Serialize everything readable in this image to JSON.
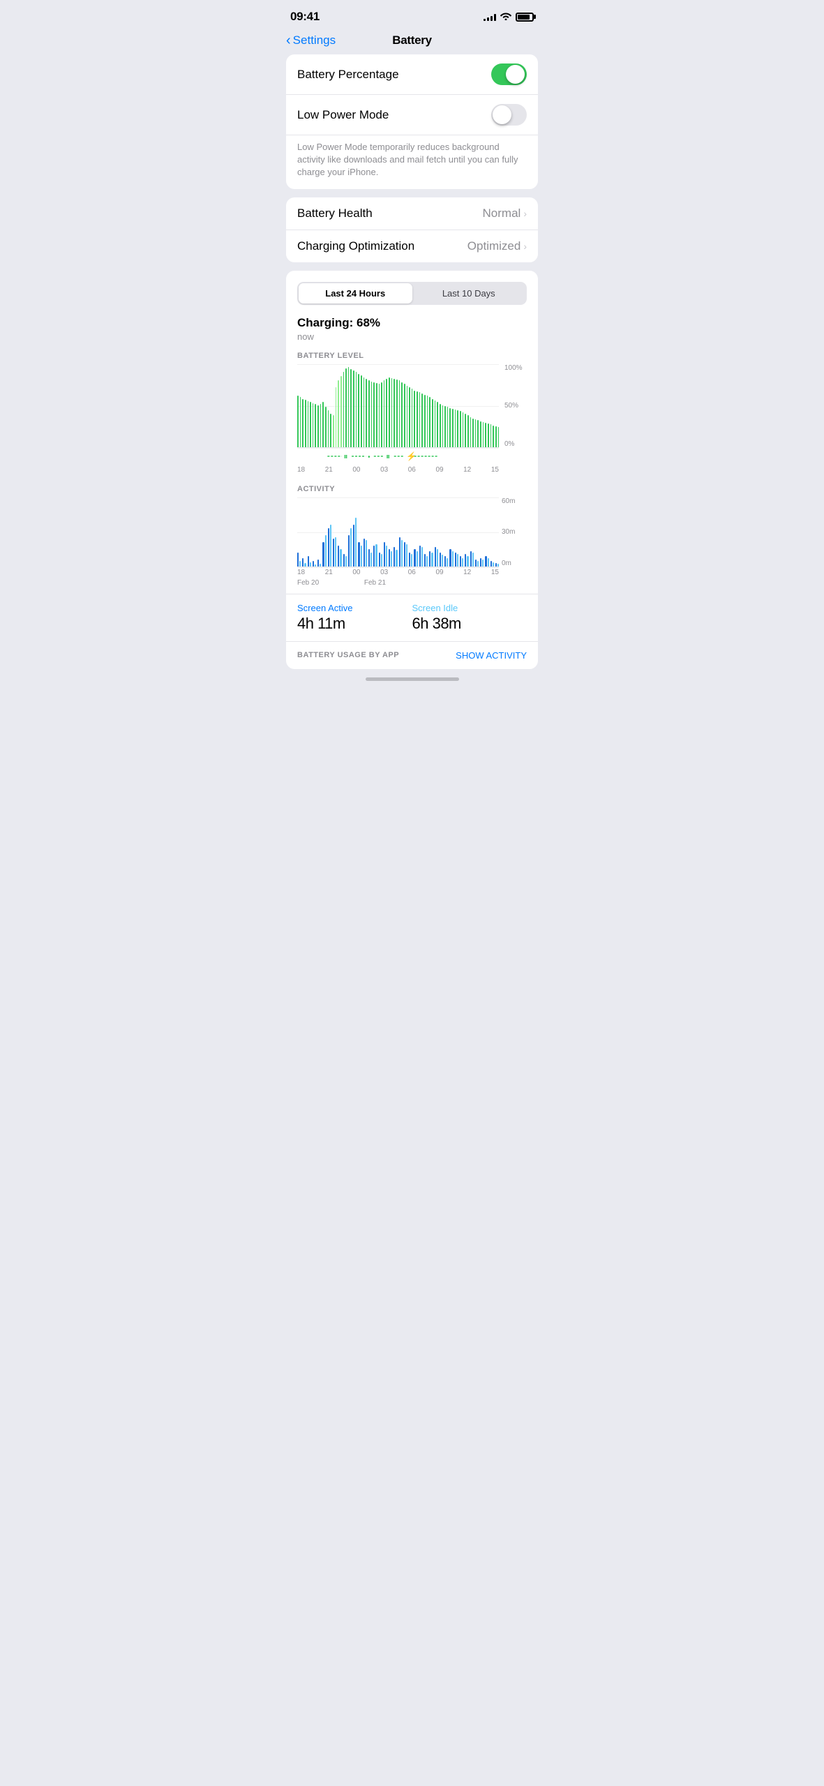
{
  "statusBar": {
    "time": "09:41",
    "signal": 4,
    "wifi": true,
    "battery": 85
  },
  "navigation": {
    "backLabel": "Settings",
    "title": "Battery"
  },
  "settings": {
    "batteryPercentage": {
      "label": "Battery Percentage",
      "value": true
    },
    "lowPowerMode": {
      "label": "Low Power Mode",
      "value": false
    },
    "lowPowerDescription": "Low Power Mode temporarily reduces background activity like downloads and mail fetch until you can fully charge your iPhone."
  },
  "batteryHealth": {
    "label": "Battery Health",
    "value": "Normal"
  },
  "chargingOptimization": {
    "label": "Charging Optimization",
    "value": "Optimized"
  },
  "chart": {
    "segmentOptions": [
      "Last 24 Hours",
      "Last 10 Days"
    ],
    "activeSegment": 0,
    "chargingStatus": "Charging: 68%",
    "chargingTime": "now",
    "batteryLevelLabel": "BATTERY LEVEL",
    "yLabels": [
      "100%",
      "50%",
      "0%"
    ],
    "xLabels": [
      "18",
      "21",
      "00",
      "03",
      "06",
      "09",
      "12",
      "15"
    ],
    "activityLabel": "ACTIVITY",
    "activityYLabels": [
      "60m",
      "30m",
      "0m"
    ],
    "activityXLabels": [
      "18",
      "21",
      "00",
      "03",
      "06",
      "09",
      "12",
      "15"
    ],
    "dateLabels": [
      "Feb 20",
      "",
      "Feb 21",
      "",
      "",
      "",
      "",
      ""
    ],
    "screenActiveLabel": "Screen Active",
    "screenActiveValue": "4h 11m",
    "screenIdleLabel": "Screen Idle",
    "screenIdleValue": "6h 38m",
    "usageByApp": "BATTERY USAGE BY APP",
    "showActivity": "SHOW ACTIVITY"
  }
}
